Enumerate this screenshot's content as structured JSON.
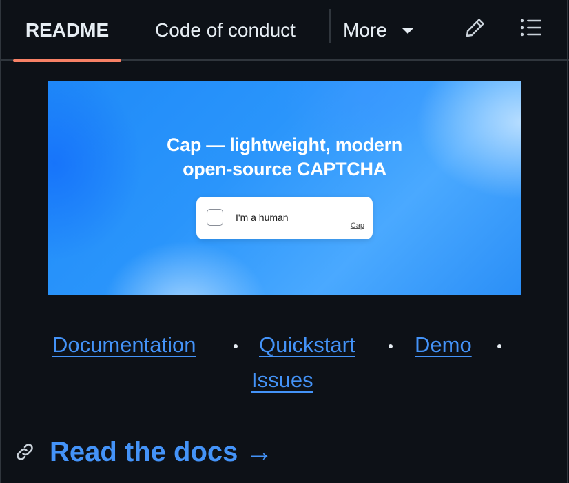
{
  "tabs": {
    "readme": "README",
    "code_of_conduct": "Code of conduct",
    "more": "More"
  },
  "banner": {
    "title_line1": "Cap — lightweight, modern",
    "title_line2": "open-source CAPTCHA",
    "checkbox_label": "I'm a human",
    "brand": "Cap"
  },
  "links": {
    "documentation": "Documentation",
    "quickstart": "Quickstart",
    "demo": "Demo",
    "issues": "Issues"
  },
  "section": {
    "heading": "Read the docs →"
  },
  "colors": {
    "background": "#0d1117",
    "link": "#4493f8",
    "active_tab_underline": "#f78166",
    "banner_blue": "#2a95fb"
  },
  "icons": [
    "caret-down-icon",
    "pencil-icon",
    "list-icon",
    "link-icon"
  ]
}
